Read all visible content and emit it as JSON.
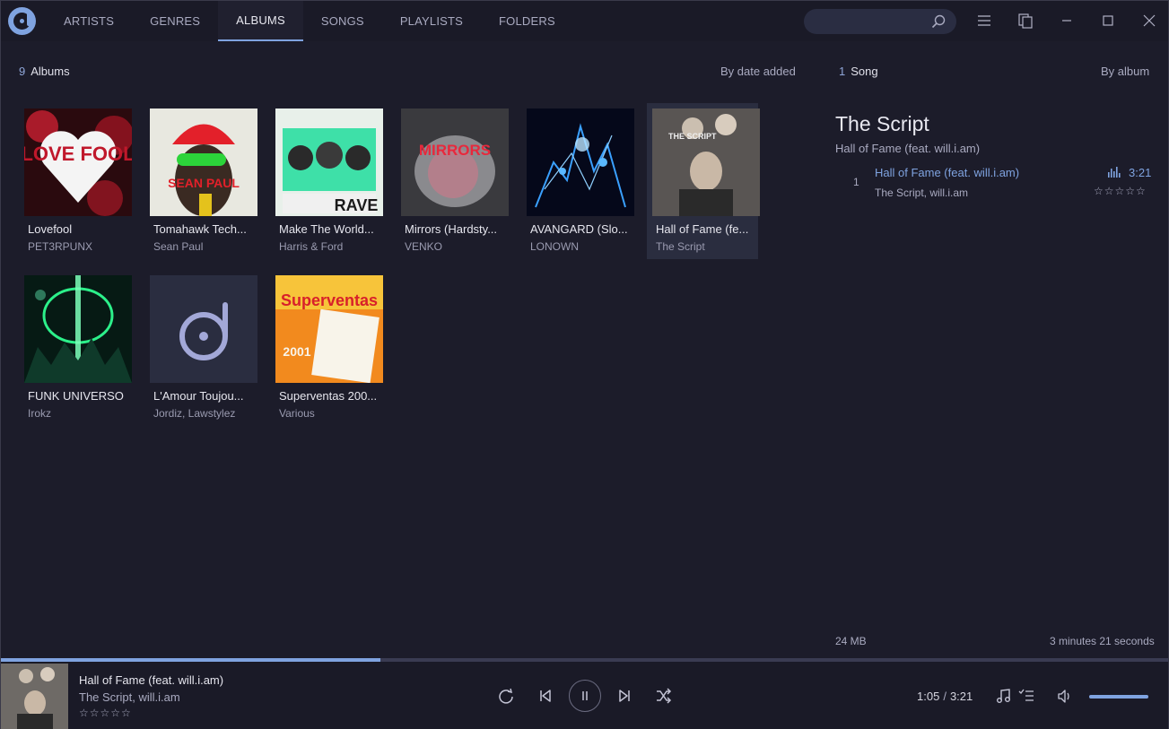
{
  "nav": {
    "tabs": [
      {
        "label": "ARTISTS"
      },
      {
        "label": "GENRES"
      },
      {
        "label": "ALBUMS"
      },
      {
        "label": "SONGS"
      },
      {
        "label": "PLAYLISTS"
      },
      {
        "label": "FOLDERS"
      }
    ],
    "active_tab": "ALBUMS",
    "search": {
      "value": "",
      "placeholder": ""
    }
  },
  "albums_panel": {
    "count": "9",
    "count_label": "Albums",
    "sort_label": "By date added",
    "albums": [
      {
        "title": "Lovefool",
        "artist": "PET3RPUNX",
        "cover_art": "LOVE FOOL"
      },
      {
        "title": "Tomahawk Tech...",
        "artist": "Sean Paul",
        "cover_art": "SEAN PAUL"
      },
      {
        "title": "Make The World...",
        "artist": "Harris & Ford",
        "cover_art": "RAVE"
      },
      {
        "title": "Mirrors (Hardsty...",
        "artist": "VENKO",
        "cover_art": "MIRRORS"
      },
      {
        "title": "AVANGARD (Slo...",
        "artist": "LONOWN",
        "cover_art": ""
      },
      {
        "title": "Hall of Fame (fe...",
        "artist": "The Script",
        "cover_art": "THE SCRIPT"
      },
      {
        "title": "FUNK UNIVERSO",
        "artist": "Irokz",
        "cover_art": ""
      },
      {
        "title": "L'Amour Toujou...",
        "artist": "Jordiz, Lawstylez",
        "cover_art": ""
      },
      {
        "title": "Superventas 200...",
        "artist": "Various",
        "cover_art": "Superventas",
        "cover_year": "2001"
      }
    ],
    "selected_index": 5
  },
  "songs_panel": {
    "count": "1",
    "count_label": "Song",
    "sort_label": "By album",
    "artist_heading": "The Script",
    "album_heading": "Hall of Fame (feat. will.i.am)",
    "tracks": [
      {
        "number": "1",
        "title": "Hall of Fame (feat. will.i.am)",
        "artist": "The Script, will.i.am",
        "duration": "3:21",
        "rating": 0,
        "rating_stars": "☆☆☆☆☆"
      }
    ],
    "size_info": "24 MB",
    "duration_info": "3 minutes 21 seconds"
  },
  "player": {
    "title": "Hall of Fame (feat. will.i.am)",
    "artist": "The Script, will.i.am",
    "rating": 0,
    "rating_stars": "☆☆☆☆☆",
    "elapsed": "1:05",
    "separator": "/",
    "total": "3:21",
    "progress_fraction": 0.325,
    "volume_fraction": 1.0
  },
  "colors": {
    "accent": "#7fa3e0",
    "background": "#1c1c2a",
    "topbar": "#1a1a27"
  },
  "icons": [
    "app-logo",
    "search-icon",
    "menu-icon",
    "miniplayer-icon",
    "minimize-icon",
    "maximize-icon",
    "close-icon",
    "equalizer-icon",
    "repeat-icon",
    "previous-icon",
    "pause-icon",
    "next-icon",
    "shuffle-icon",
    "lyrics-icon",
    "queue-icon",
    "volume-icon"
  ]
}
